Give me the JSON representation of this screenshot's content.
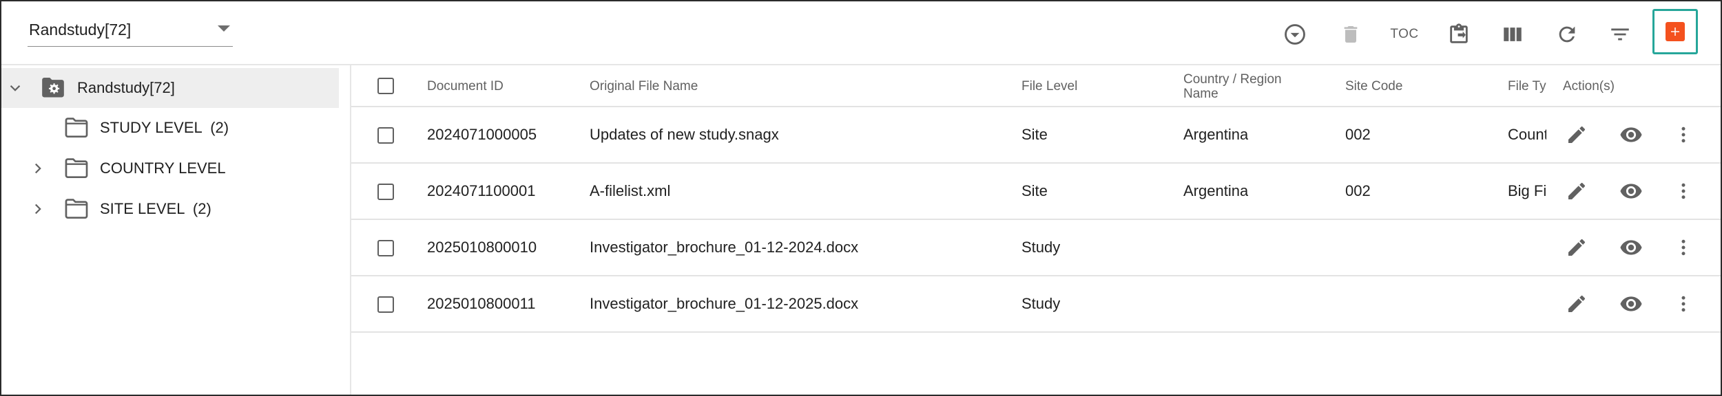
{
  "study_select": {
    "value": "Randstudy[72]"
  },
  "toolbar": {
    "toc_label": "TOC",
    "icons": [
      "filter-dropdown-icon",
      "delete-icon",
      "toc",
      "paste-export-icon",
      "columns-icon",
      "refresh-icon",
      "sort-filter-icon",
      "add-icon"
    ],
    "accent_color": "#f4511e",
    "highlight_color": "#26a69a"
  },
  "tree": {
    "root": {
      "label": "Randstudy[72]"
    },
    "items": [
      {
        "label": "STUDY LEVEL",
        "count": "(2)",
        "expandable": false
      },
      {
        "label": "COUNTRY LEVEL",
        "count": "",
        "expandable": true
      },
      {
        "label": "SITE LEVEL",
        "count": "(2)",
        "expandable": true
      }
    ]
  },
  "table": {
    "headers": {
      "document_id": "Document ID",
      "original_file_name": "Original File Name",
      "file_level": "File Level",
      "country_region_line1": "Country / Region",
      "country_region_line2": "Name",
      "site_code": "Site Code",
      "file_type": "File Ty",
      "actions": "Action(s)"
    },
    "rows": [
      {
        "document_id": "2024071000005",
        "file_name": "Updates of new study.snagx",
        "file_level": "Site",
        "country": "Argentina",
        "site_code": "002",
        "file_type": "Count"
      },
      {
        "document_id": "2024071100001",
        "file_name": "A-filelist.xml",
        "file_level": "Site",
        "country": "Argentina",
        "site_code": "002",
        "file_type": "Big Fi"
      },
      {
        "document_id": "2025010800010",
        "file_name": "Investigator_brochure_01-12-2024.docx",
        "file_level": "Study",
        "country": "",
        "site_code": "",
        "file_type": ""
      },
      {
        "document_id": "2025010800011",
        "file_name": "Investigator_brochure_01-12-2025.docx",
        "file_level": "Study",
        "country": "",
        "site_code": "",
        "file_type": ""
      }
    ]
  }
}
